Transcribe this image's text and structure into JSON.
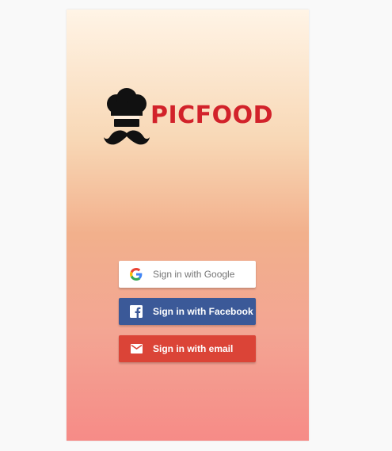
{
  "app": {
    "logo_text": "PICFOOD",
    "brand_color": "#d2222a"
  },
  "auth": {
    "google": {
      "label": "Sign in with Google",
      "icon": "google-icon",
      "color": "#ffffff"
    },
    "facebook": {
      "label": "Sign in with Facebook",
      "icon": "facebook-icon",
      "color": "#3b5998"
    },
    "email": {
      "label": "Sign in with email",
      "icon": "mail-icon",
      "color": "#db4437"
    }
  }
}
